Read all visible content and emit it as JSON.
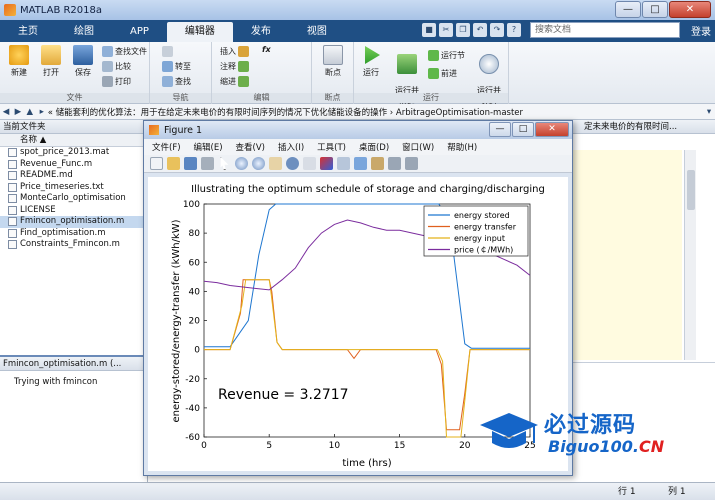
{
  "window": {
    "title": "MATLAB R2018a",
    "min": "—",
    "max": "□",
    "close": "✕"
  },
  "tabs": [
    "主页",
    "绘图",
    "APP",
    "编辑器",
    "发布",
    "视图"
  ],
  "search": {
    "placeholder": "搜索文档"
  },
  "login": "登录",
  "ribbon": {
    "file": {
      "label": "文件",
      "new": "新建",
      "open": "打开",
      "save": "保存",
      "find_files": "查找文件",
      "compare": "比较",
      "print": "打印"
    },
    "navigate": {
      "label": "导航",
      "goto": "转至",
      "find": "查找"
    },
    "edit": {
      "label": "编辑",
      "insert": "插入",
      "comment": "注释",
      "indent": "缩进",
      "fx": "fx"
    },
    "breakpoints": {
      "label": "断点",
      "breakpoints": "断点"
    },
    "run": {
      "label": "运行",
      "run": "运行",
      "run_advance": "运行并\n前进",
      "run_section": "运行节",
      "advance": "前进",
      "run_time": "运行并\n计时"
    }
  },
  "address": "« 储能套利的优化算法：用于在给定未来电价的有限时间序列的情况下优化储能设备的操作 › ArbitrageOptimisation-master",
  "folder_panel": {
    "title": "当前文件夹",
    "column": "名称 ▲",
    "files": [
      "spot_price_2013.mat",
      "Revenue_Func.m",
      "README.md",
      "Price_timeseries.txt",
      "MonteCarlo_optimisation",
      "LICENSE",
      "Fmincon_optimisation.m",
      "Find_optimisation.m",
      "Constraints_Fmincon.m"
    ],
    "selected_index": 6
  },
  "details_panel": {
    "title": "Fmincon_optimisation.m (...",
    "text": "Trying with fmincon"
  },
  "editor_tab": "定未来电价的有限时间...",
  "status": {
    "position": "行  1",
    "column": "列  1"
  },
  "figure": {
    "title": "Figure 1",
    "menu": [
      "文件(F)",
      "编辑(E)",
      "查看(V)",
      "插入(I)",
      "工具(T)",
      "桌面(D)",
      "窗口(W)",
      "帮助(H)"
    ]
  },
  "chart_data": {
    "type": "line",
    "title": "Illustrating the optimum schedule of storage and charging/discharging",
    "xlabel": "time (hrs)",
    "ylabel": "energy-stored/energy-transfer (kWh/kW)",
    "xlim": [
      0,
      25
    ],
    "ylim": [
      -60,
      100
    ],
    "xticks": [
      0,
      5,
      10,
      15,
      20,
      25
    ],
    "yticks": [
      -60,
      -40,
      -20,
      0,
      20,
      40,
      60,
      80,
      100
    ],
    "annotation": "Revenue = 3.2717",
    "legend_position": "top-right",
    "series": [
      {
        "name": "energy stored",
        "color": "#1f77d0",
        "x": [
          0,
          2,
          3.4,
          4.2,
          5,
          5.5,
          6.5,
          10,
          15,
          18,
          18.8,
          19.5,
          20,
          20.5,
          25
        ],
        "y": [
          2,
          2,
          20,
          65,
          96,
          100,
          100,
          100,
          100,
          100,
          90,
          40,
          4,
          1,
          1
        ]
      },
      {
        "name": "energy transfer",
        "color": "#e0601e",
        "x": [
          0,
          2,
          2.8,
          3,
          3.6,
          5,
          5.2,
          5.6,
          6,
          11,
          11.5,
          12,
          17.8,
          18.2,
          18.6,
          19.6,
          20,
          20.4,
          25
        ],
        "y": [
          0,
          0,
          25,
          48,
          48,
          48,
          40,
          5,
          0,
          0,
          -6,
          0,
          0,
          -10,
          -55,
          -55,
          -30,
          0,
          0
        ]
      },
      {
        "name": "energy input",
        "color": "#e3b21a",
        "x": [
          0,
          2,
          2.9,
          3.2,
          3.6,
          5,
          5.1,
          5.6,
          6,
          17.9,
          18.3,
          18.6,
          19.7,
          20,
          20.4,
          25
        ],
        "y": [
          0,
          0,
          30,
          48,
          48,
          48,
          42,
          5,
          0,
          0,
          -8,
          -60,
          -60,
          -35,
          0,
          0
        ]
      },
      {
        "name": "price (￠/MWh)",
        "color": "#7b2d9e",
        "x": [
          0,
          1,
          2,
          3,
          4,
          5,
          6,
          7,
          8,
          9,
          10,
          11,
          12,
          13,
          14,
          15,
          16,
          17,
          18,
          19,
          20,
          21,
          22,
          23,
          24,
          25
        ],
        "y": [
          47,
          46,
          44,
          43,
          42,
          41,
          48,
          56,
          70,
          80,
          86,
          89,
          87,
          84,
          82,
          82,
          80,
          78,
          77,
          76,
          80,
          72,
          66,
          62,
          58,
          51
        ]
      }
    ]
  },
  "watermark": {
    "zh": "必过源码",
    "en_main": "Biguo100.",
    "en_tld": "CN"
  }
}
